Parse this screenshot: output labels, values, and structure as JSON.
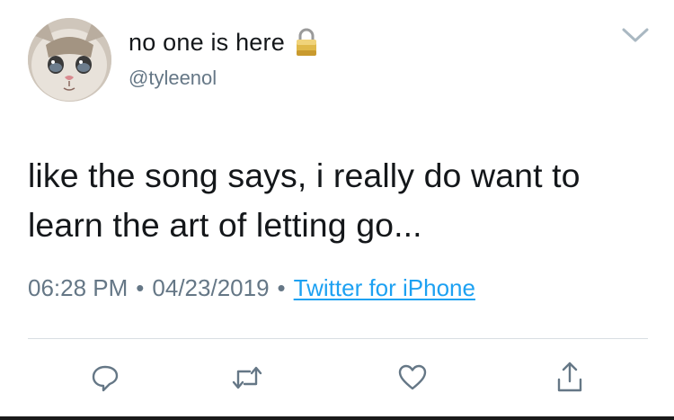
{
  "user": {
    "display_name": "no one is here",
    "handle": "@tyleenol",
    "protected_icon": "lock-icon",
    "avatar_icon": "crying-cat-avatar"
  },
  "menu": {
    "icon": "chevron-down-icon"
  },
  "tweet": {
    "text": "like the song says, i really do want to learn the art of letting go...",
    "time": "06:28 PM",
    "separator": "•",
    "date": "04/23/2019",
    "source": "Twitter for iPhone"
  },
  "actions": [
    {
      "name": "reply",
      "icon": "reply-icon"
    },
    {
      "name": "retweet",
      "icon": "retweet-icon"
    },
    {
      "name": "like",
      "icon": "heart-icon"
    },
    {
      "name": "share",
      "icon": "share-icon"
    }
  ],
  "colors": {
    "text": "#14171a",
    "secondary": "#657786",
    "link": "#1da1f2",
    "divider": "#d8dee3",
    "lock_gold": "#d9b84a"
  }
}
